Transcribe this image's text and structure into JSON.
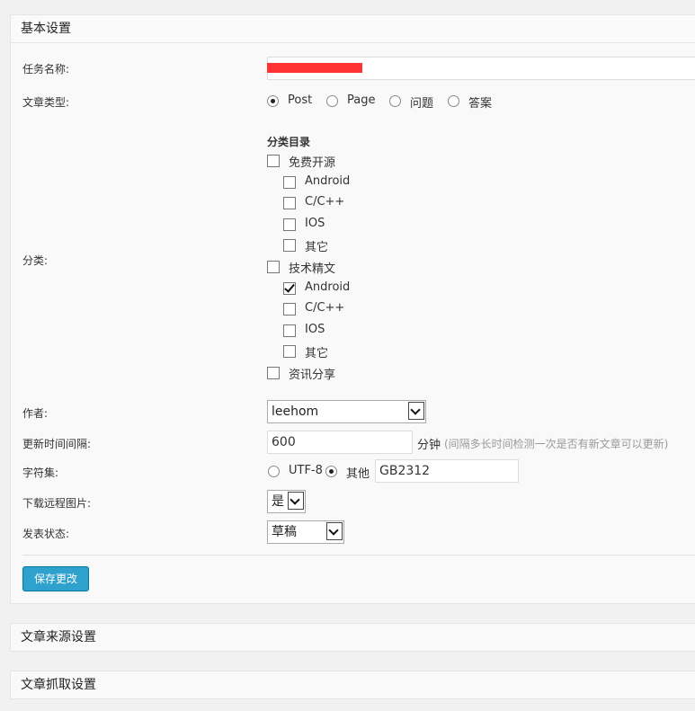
{
  "panels": {
    "basic": "基本设置",
    "source": "文章来源设置",
    "fetch": "文章抓取设置"
  },
  "fields": {
    "task_name_label": "任务名称:",
    "task_name_value": "",
    "post_type_label": "文章类型:",
    "post_types": [
      "Post",
      "Page",
      "问题",
      "答案"
    ],
    "post_type_selected": "Post",
    "category_label": "分类:",
    "category_heading": "分类目录",
    "categories": [
      {
        "label": "免费开源",
        "checked": false,
        "level": 0
      },
      {
        "label": "Android",
        "checked": false,
        "level": 1
      },
      {
        "label": "C/C++",
        "checked": false,
        "level": 1
      },
      {
        "label": "IOS",
        "checked": false,
        "level": 1
      },
      {
        "label": "其它",
        "checked": false,
        "level": 1
      },
      {
        "label": "技术精文",
        "checked": false,
        "level": 0
      },
      {
        "label": "Android",
        "checked": true,
        "level": 1
      },
      {
        "label": "C/C++",
        "checked": false,
        "level": 1
      },
      {
        "label": "IOS",
        "checked": false,
        "level": 1
      },
      {
        "label": "其它",
        "checked": false,
        "level": 1
      },
      {
        "label": "资讯分享",
        "checked": false,
        "level": 0
      }
    ],
    "author_label": "作者:",
    "author_value": "leehom",
    "interval_label": "更新时间间隔:",
    "interval_value": "600",
    "interval_unit": "分钟",
    "interval_hint": "(间隔多长时间检测一次是否有新文章可以更新)",
    "charset_label": "字符集:",
    "charset_utf8": "UTF-8",
    "charset_other": "其他",
    "charset_selected": "其他",
    "charset_value": "GB2312",
    "download_images_label": "下载远程图片:",
    "download_images_value": "是",
    "publish_status_label": "发表状态:",
    "publish_status_value": "草稿"
  },
  "save_button": "保存更改",
  "colors": {
    "primary_button": "#2ea2cc",
    "redaction": "#ff3333"
  }
}
